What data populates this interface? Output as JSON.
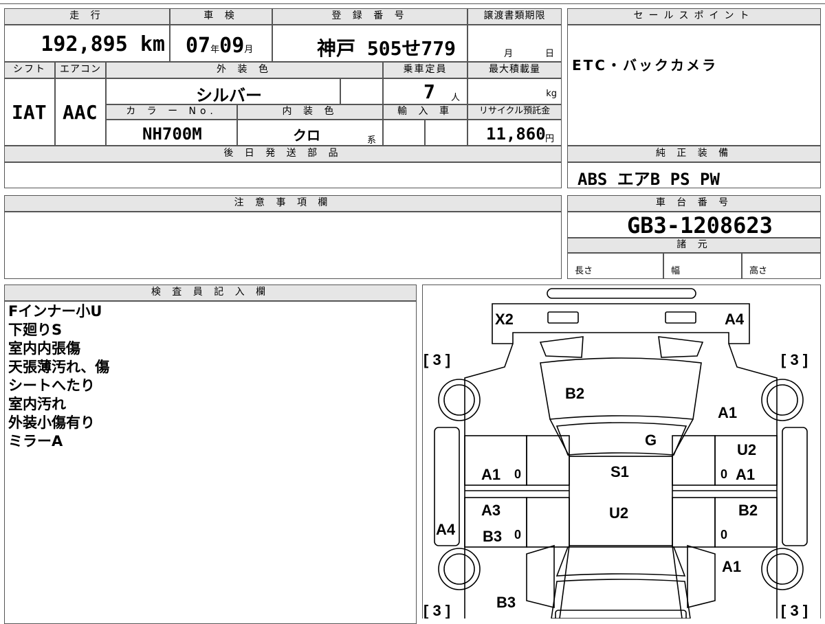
{
  "vehicle": {
    "mileage_label": "走 行",
    "mileage_value": "192,895",
    "mileage_unit": "km",
    "inspection_label": "車 検",
    "inspection_year": "07",
    "inspection_year_unit": "年",
    "inspection_month": "09",
    "inspection_month_unit": "月",
    "registration_label": "登 録 番 号",
    "registration_value": "神戸 505せ779",
    "transfer_label": "譲渡書類期限",
    "transfer_month_unit": "月",
    "transfer_day_unit": "日",
    "shift_label": "シフト",
    "shift_value": "IAT",
    "aircon_label": "エアコン",
    "aircon_value": "AAC",
    "exterior_color_label": "外 装 色",
    "exterior_color_value": "シルバー",
    "capacity_label": "乗車定員",
    "capacity_value": "7",
    "capacity_unit": "人",
    "max_load_label": "最大積載量",
    "max_load_unit": "kg",
    "color_no_label": "カ ラ ー No.",
    "color_no_value": "NH700M",
    "interior_color_label": "内 装 色",
    "interior_color_value": "クロ",
    "interior_color_suffix": "系",
    "import_label": "輸 入 車",
    "recycle_label": "リサイクル預託金",
    "recycle_value": "11,860",
    "recycle_unit": "円"
  },
  "sales_point": {
    "label": "セールスポイント",
    "value": "ETC・バックカメラ"
  },
  "later_parts": {
    "label": "後 日 発 送 部 品"
  },
  "equipment": {
    "label": "純 正 装 備",
    "value": "ABS エアB PS PW"
  },
  "notes": {
    "label": "注 意 事 項 欄"
  },
  "chassis": {
    "label": "車 台 番 号",
    "value": "GB3-1208623",
    "specs_label": "諸 元",
    "length_label": "長さ",
    "width_label": "幅",
    "height_label": "高さ"
  },
  "inspector": {
    "label": "検 査 員 記 入 欄",
    "lines": [
      "Fインナー小U",
      "下廻りS",
      "室内内張傷",
      "天張薄汚れ、傷",
      "シートへたり",
      "室内汚れ",
      "外装小傷有り",
      "ミラーA"
    ]
  },
  "diagram": {
    "tire_tl": "[ 3 ]",
    "tire_tr": "[ 3 ]",
    "tire_bl": "[ 3 ]",
    "tire_br": "[ 3 ]",
    "mark_x2": "X2",
    "mark_a4_top": "A4",
    "mark_b2_hood": "B2",
    "mark_a1_right_front": "A1",
    "mark_g": "G",
    "mark_u2_right": "U2",
    "mark_a1_left_door": "A1",
    "mark_0_left_1": "0",
    "mark_s1": "S1",
    "mark_0_right_1": "0",
    "mark_a1_right_door": "A1",
    "mark_a3": "A3",
    "mark_u2_center": "U2",
    "mark_b2_right_door": "B2",
    "mark_a4_left": "A4",
    "mark_b3_left_door": "B3",
    "mark_0_left_2": "0",
    "mark_0_right_2": "0",
    "mark_a1_right_rear": "A1",
    "mark_b3_rear": "B3"
  }
}
